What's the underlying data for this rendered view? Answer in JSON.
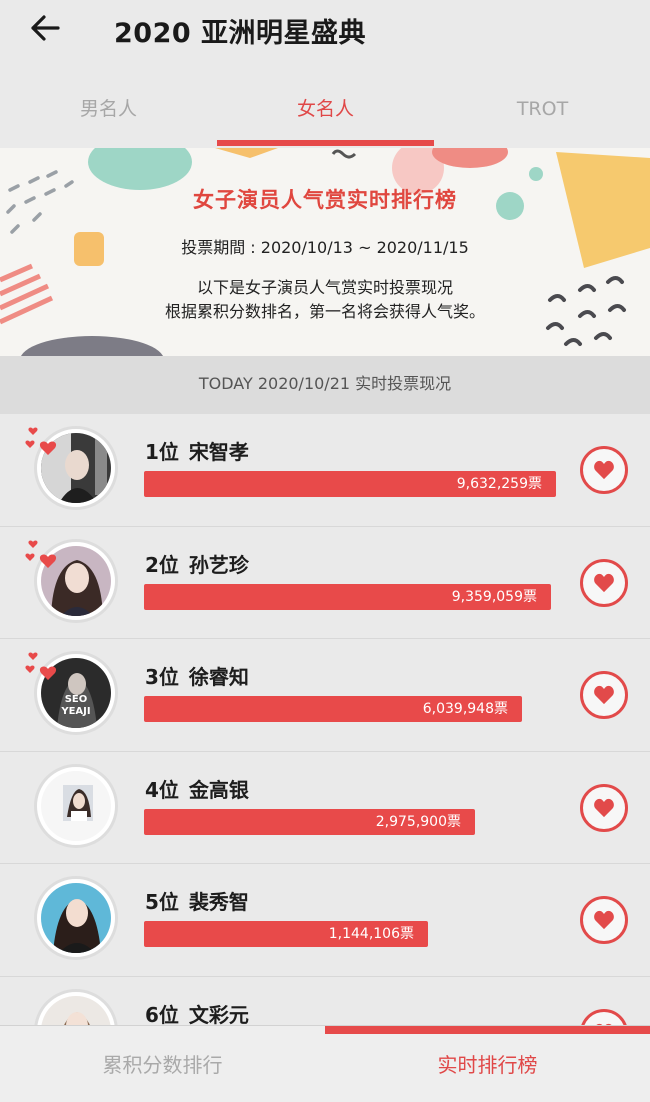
{
  "header": {
    "title": "2020 亚洲明星盛典",
    "back_icon": "arrow-left-icon"
  },
  "tabs": [
    {
      "label": "男名人",
      "active": false
    },
    {
      "label": "女名人",
      "active": true
    },
    {
      "label": "TROT",
      "active": false
    }
  ],
  "banner": {
    "title": "女子演员人气赏实时排行榜",
    "period": "投票期間 : 2020/10/13 ~ 2020/11/15",
    "desc_line1": "以下是女子演员人气赏实时投票现况",
    "desc_line2": "根据累积分数排名，第一名将会获得人气奖。"
  },
  "today": {
    "text": "TODAY 2020/10/21 实时投票现况"
  },
  "rankings": [
    {
      "rank": "1位",
      "name": "宋智孝",
      "votes": "9,632,259票",
      "vote_count": 9632259,
      "hearts": true
    },
    {
      "rank": "2位",
      "name": "孙艺珍",
      "votes": "9,359,059票",
      "vote_count": 9359059,
      "hearts": true
    },
    {
      "rank": "3位",
      "name": "徐睿知",
      "votes": "6,039,948票",
      "vote_count": 6039948,
      "hearts": true,
      "avatar_text": "SEO YEA JI"
    },
    {
      "rank": "4位",
      "name": "金高银",
      "votes": "2,975,900票",
      "vote_count": 2975900,
      "hearts": false
    },
    {
      "rank": "5位",
      "name": "裴秀智",
      "votes": "1,144,106票",
      "vote_count": 1144106,
      "hearts": false
    },
    {
      "rank": "6位",
      "name": "文彩元",
      "votes": "",
      "vote_count": null,
      "hearts": false
    }
  ],
  "bottom_nav": [
    {
      "label": "累积分数排行",
      "active": false
    },
    {
      "label": "实时排行榜",
      "active": true
    }
  ],
  "colors": {
    "accent": "#e64a4a",
    "inactive": "#a7a7a7"
  }
}
